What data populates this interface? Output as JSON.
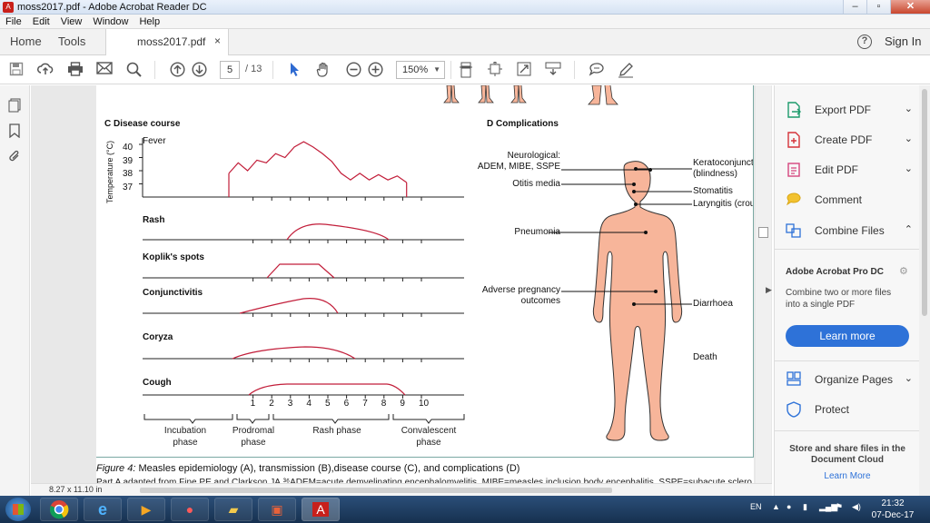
{
  "window": {
    "title": "moss2017.pdf - Adobe Acrobat Reader DC",
    "minimize": "–",
    "maximize": "▫",
    "close": "✕"
  },
  "menu": [
    "File",
    "Edit",
    "View",
    "Window",
    "Help"
  ],
  "tabs": {
    "home": "Home",
    "tools": "Tools",
    "doc": "moss2017.pdf",
    "doc_close": "×",
    "help": "?",
    "signin": "Sign In"
  },
  "toolbar": {
    "page_current": "5",
    "page_total": "/ 13",
    "zoom": "150%"
  },
  "figure": {
    "panel_c_title": "C   Disease course",
    "panel_d_title": "D   Complications",
    "y_axis_label": "Temperature (°C)",
    "y_ticks": [
      "40",
      "39",
      "38",
      "37"
    ],
    "rows": [
      "Fever",
      "Rash",
      "Koplik's spots",
      "Conjunctivitis",
      "Coryza",
      "Cough"
    ],
    "days": [
      "1",
      "2",
      "3",
      "4",
      "5",
      "6",
      "7",
      "8",
      "9",
      "10"
    ],
    "phases": [
      {
        "line1": "Incubation",
        "line2": "phase"
      },
      {
        "line1": "Prodromal",
        "line2": "phase"
      },
      {
        "line1": "Rash phase",
        "line2": ""
      },
      {
        "line1": "Convalescent",
        "line2": "phase"
      }
    ],
    "complications_left": [
      {
        "line1": "Neurological:",
        "line2": "ADEM, MIBE, SSPE"
      },
      {
        "line1": "Otitis media",
        "line2": ""
      },
      {
        "line1": "Pneumonia",
        "line2": ""
      },
      {
        "line1": "Adverse pregnancy",
        "line2": "outcomes"
      }
    ],
    "complications_right": [
      {
        "line1": "Keratoconjuncti",
        "line2": "(blindness)"
      },
      {
        "line1": "Stomatitis",
        "line2": ""
      },
      {
        "line1": "Laryngitis (crou",
        "line2": ""
      },
      {
        "line1": "Diarrhoea",
        "line2": ""
      },
      {
        "line1": "Death",
        "line2": ""
      }
    ],
    "caption_label": "Figure 4:",
    "caption_text": " Measles epidemiology (A), transmission (B),disease course (C), and complications (D)",
    "footnote": "Part A adapted from Fine PE and Clarkson JA.³⁶ADEM=acute demyelinating encephalomyelitis. MIBE=measles inclusion body encephalitis. SSPE=subacute sclero",
    "colors": {
      "curve": "#c21e3a",
      "body": "#f7b59a",
      "rule": "#7ba9a3"
    }
  },
  "chart_data": {
    "type": "line",
    "title": "Disease course",
    "xlabel": "",
    "ylabel": "Temperature (°C)",
    "x": [
      0,
      0.5,
      1,
      1.5,
      2,
      2.5,
      3,
      3.5,
      4,
      4.5,
      5,
      5.5,
      6,
      6.5,
      7,
      7.5,
      8,
      8.5,
      9,
      9.5
    ],
    "series": [
      {
        "name": "Fever",
        "values": [
          37.8,
          38.6,
          38.0,
          38.8,
          38.6,
          39.3,
          39.0,
          39.8,
          40.2,
          39.8,
          39.3,
          38.7,
          37.8,
          37.3,
          37.8,
          37.3,
          37.7,
          37.3,
          37.6,
          37.1
        ]
      }
    ],
    "ylim": [
      36,
      40.5
    ]
  },
  "right_panel": {
    "items": [
      {
        "label": "Export PDF",
        "chevron": "⌄"
      },
      {
        "label": "Create PDF",
        "chevron": "⌄"
      },
      {
        "label": "Edit PDF",
        "chevron": "⌄"
      },
      {
        "label": "Comment",
        "chevron": ""
      },
      {
        "label": "Combine Files",
        "chevron": "⌃"
      }
    ],
    "promo_title": "Adobe Acrobat Pro DC",
    "promo_text": "Combine two or more files into a single PDF",
    "learn_button": "Learn more",
    "items2": [
      {
        "label": "Organize Pages",
        "chevron": "⌄"
      },
      {
        "label": "Protect",
        "chevron": ""
      }
    ],
    "store_text": "Store and share files in the Document Cloud",
    "learn_link": "Learn More"
  },
  "status": {
    "page_size": "8.27 x 11.10 in"
  },
  "taskbar": {
    "lang": "EN",
    "time": "21:32",
    "date": "07-Dec-17"
  }
}
